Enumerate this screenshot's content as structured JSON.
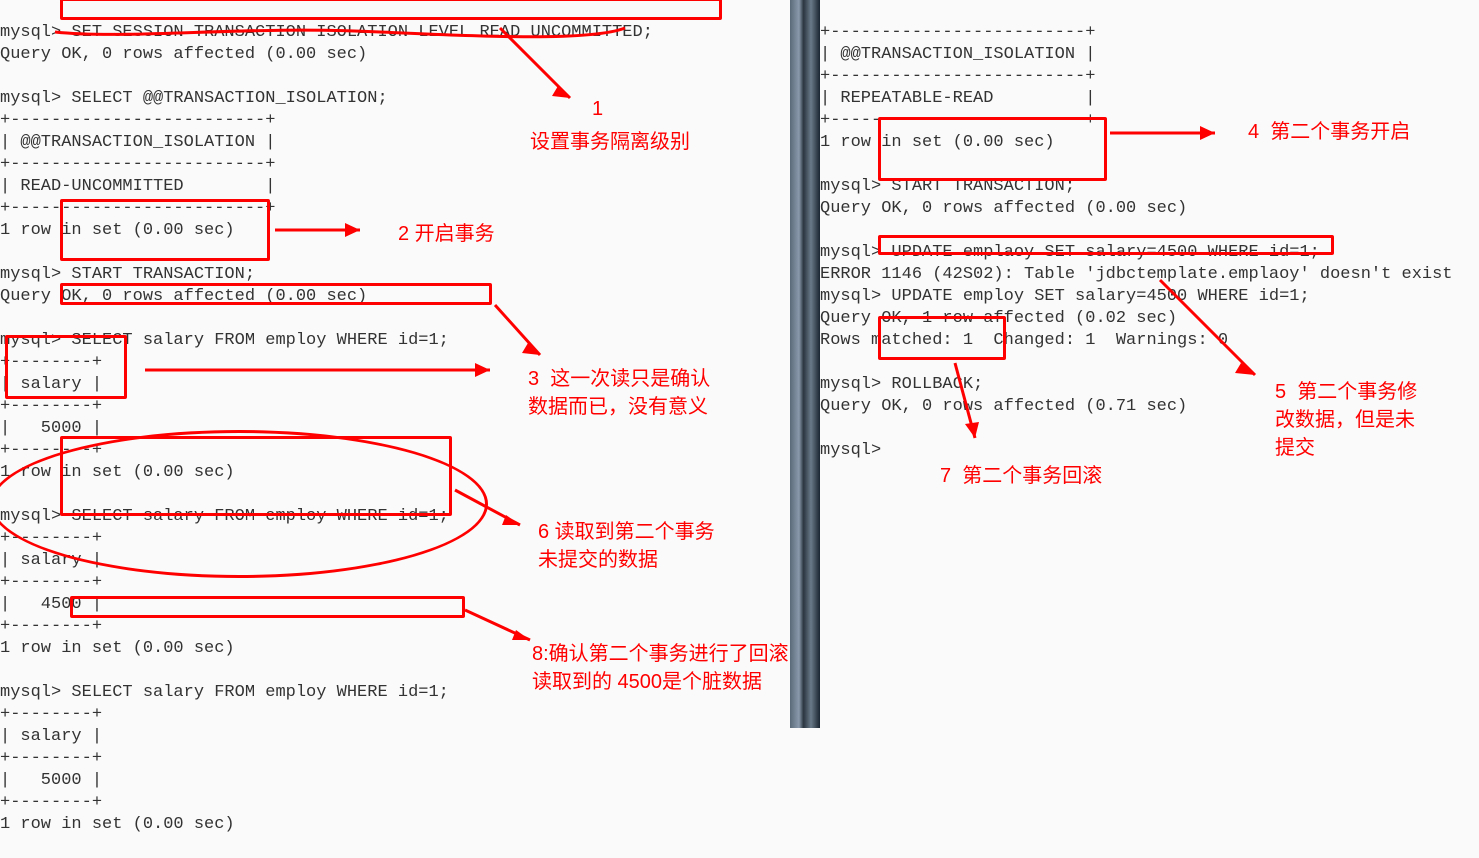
{
  "left_terminal": [
    "mysql> SET SESSION TRANSACTION ISOLATION LEVEL READ UNCOMMITTED;",
    "Query OK, 0 rows affected (0.00 sec)",
    "",
    "mysql> SELECT @@TRANSACTION_ISOLATION;",
    "+-------------------------+",
    "| @@TRANSACTION_ISOLATION |",
    "+-------------------------+",
    "| READ-UNCOMMITTED        |",
    "+-------------------------+",
    "1 row in set (0.00 sec)",
    "",
    "mysql> START TRANSACTION;",
    "Query OK, 0 rows affected (0.00 sec)",
    "",
    "mysql> SELECT salary FROM employ WHERE id=1;",
    "+--------+",
    "| salary |",
    "+--------+",
    "|   5000 |",
    "+--------+",
    "1 row in set (0.00 sec)",
    "",
    "mysql> SELECT salary FROM employ WHERE id=1;",
    "+--------+",
    "| salary |",
    "+--------+",
    "|   4500 |",
    "+--------+",
    "1 row in set (0.00 sec)",
    "",
    "mysql> SELECT salary FROM employ WHERE id=1;",
    "+--------+",
    "| salary |",
    "+--------+",
    "|   5000 |",
    "+--------+",
    "1 row in set (0.00 sec)"
  ],
  "right_terminal": [
    "+-------------------------+",
    "| @@TRANSACTION_ISOLATION |",
    "+-------------------------+",
    "| REPEATABLE-READ         |",
    "+-------------------------+",
    "1 row in set (0.00 sec)",
    "",
    "mysql> START TRANSACTION;",
    "Query OK, 0 rows affected (0.00 sec)",
    "",
    "mysql> UPDATE emplaoy SET salary=4500 WHERE id=1;",
    "ERROR 1146 (42S02): Table 'jdbctemplate.emplaoy' doesn't exist",
    "mysql> UPDATE employ SET salary=4500 WHERE id=1;",
    "Query OK, 1 row affected (0.02 sec)",
    "Rows matched: 1  Changed: 1  Warnings: 0",
    "",
    "mysql> ROLLBACK;",
    "Query OK, 0 rows affected (0.71 sec)",
    "",
    "mysql>"
  ],
  "annotations": {
    "a1_num": "1",
    "a1": "设置事务隔离级别",
    "a2": "2 开启事务",
    "a3": "3  这一次读只是确认\n数据而已，没有意义",
    "a4": "4  第二个事务开启",
    "a5": "5  第二个事务修\n改数据，但是未\n提交",
    "a6": "6 读取到第二个事务\n未提交的数据",
    "a7": "7  第二个事务回滚",
    "a8": "8:确认第二个事务进行了回滚\n读取到的 4500是个脏数据"
  }
}
